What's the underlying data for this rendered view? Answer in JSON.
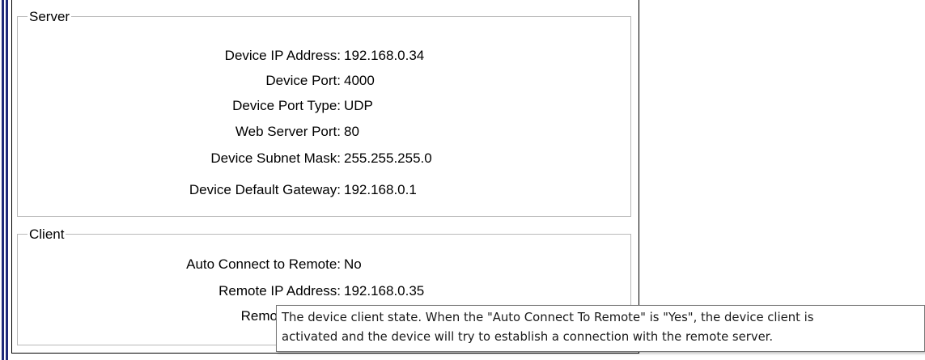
{
  "server": {
    "legend": "Server",
    "fields": [
      {
        "label": "Device IP Address:",
        "value": "192.168.0.34"
      },
      {
        "label": "Device Port:",
        "value": "4000"
      },
      {
        "label": "Device Port Type:",
        "value": "UDP"
      },
      {
        "label": "Web Server Port:",
        "value": "80"
      },
      {
        "label": "Device Subnet Mask:",
        "value": "255.255.255.0"
      },
      {
        "label": "Device Default Gateway:",
        "value": "192.168.0.1"
      }
    ]
  },
  "client": {
    "legend": "Client",
    "fields": [
      {
        "label": "Auto Connect to Remote:",
        "value": "No"
      },
      {
        "label": "Remote IP Address:",
        "value": "192.168.0.35"
      },
      {
        "label": "Remo",
        "value": ""
      }
    ]
  },
  "tooltip": {
    "line1": "The device client state. When the \"Auto Connect To Remote\" is \"Yes\", the device client is",
    "line2": "activated and the device will try to establish a connection with the remote server."
  },
  "colors": {
    "accent_bar": "#1f2b7a",
    "group_border": "#b9b9b9"
  }
}
